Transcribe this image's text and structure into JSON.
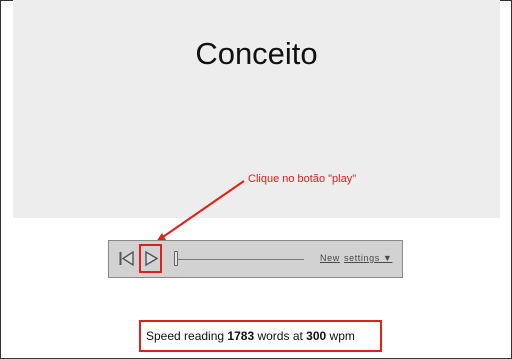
{
  "display": {
    "word": "Conceito"
  },
  "annotation": {
    "text": "Clique no botão \"play\"",
    "color": "#e0201a"
  },
  "player": {
    "buttons": [
      {
        "name": "rewind",
        "icon": "skip-back-icon"
      },
      {
        "name": "play",
        "icon": "play-icon"
      }
    ],
    "new_label": "New",
    "settings_label": "settings ▼",
    "progress": 0
  },
  "status": {
    "prefix": "Speed reading",
    "word_count": "1783",
    "middle": "words at",
    "wpm": "300",
    "suffix": "wpm"
  },
  "colors": {
    "accent": "#e0201a",
    "display_bg": "#ecedec",
    "player_bg": "#d2d2d2"
  }
}
